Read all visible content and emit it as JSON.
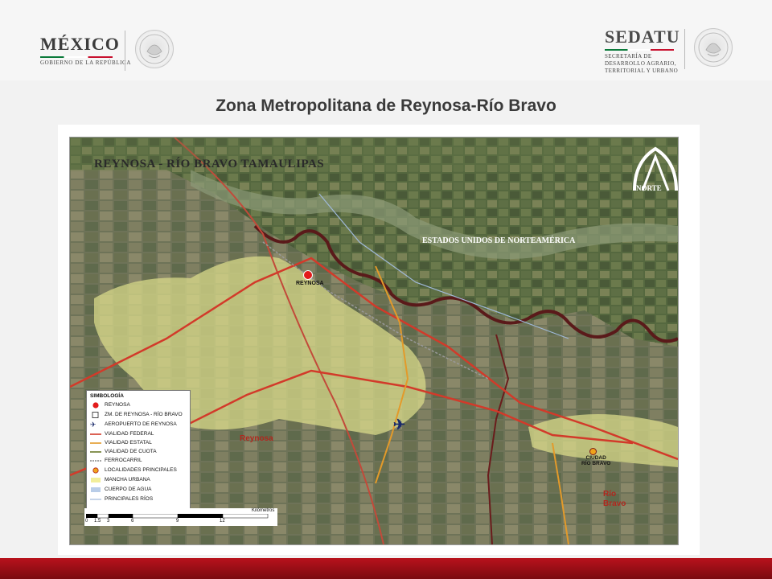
{
  "header": {
    "left_logo": {
      "name": "MÉXICO",
      "subtitle": "GOBIERNO DE LA REPÚBLICA"
    },
    "right_logo": {
      "name": "SEDATU",
      "line1": "SECRETARÍA DE",
      "line2": "DESARROLLO AGRARIO,",
      "line3": "TERRITORIAL Y URBANO"
    },
    "seal_text": "ESTADOS UNIDOS MEXICANOS"
  },
  "title": "Zona Metropolitana de Reynosa-Río Bravo",
  "map": {
    "banner": "REYNOSA - RÍO BRAVO  TAMAULIPAS",
    "north_label": "NORTE",
    "usa_label": "ESTADOS UNIDOS DE NORTEAMÉRICA",
    "reynosa_point": "REYNOSA",
    "reynosa_area": "Reynosa",
    "ciudad_rio_bravo_line1": "CIUDAD",
    "ciudad_rio_bravo_line2": "RÍO BRAVO",
    "rio_bravo_area_line1": "Río",
    "rio_bravo_area_line2": "Bravo",
    "colors": {
      "urban": "#d8d98a",
      "river_border": "#5a1a1a",
      "federal_road": "#d23a2a",
      "state_road": "#e39a2a",
      "toll_road": "#6b7a2a",
      "rivers": "#9fb8d8"
    }
  },
  "legend": {
    "title": "SIMBOLOGÍA",
    "items": [
      {
        "label": "REYNOSA",
        "icon": "red-circle"
      },
      {
        "label": "ZM. DE REYNOSA - RÍO BRAVO",
        "icon": "outline-square"
      },
      {
        "label": "AEROPUERTO DE REYNOSA",
        "icon": "airplane"
      },
      {
        "label": "VIALIDAD FEDERAL",
        "icon": "red-line"
      },
      {
        "label": "VIALIDAD ESTATAL",
        "icon": "orange-line"
      },
      {
        "label": "VIALIDAD DE CUOTA",
        "icon": "olive-line"
      },
      {
        "label": "FERROCARRIL",
        "icon": "railway-line"
      },
      {
        "label": "LOCALIDADES PRINCIPALES",
        "icon": "orange-circle"
      },
      {
        "label": "MANCHA URBANA",
        "icon": "yellow-fill"
      },
      {
        "label": "CUERPO DE AGUA",
        "icon": "blue-fill"
      },
      {
        "label": "PRINCIPALES RÍOS",
        "icon": "blue-line"
      }
    ]
  },
  "scale": {
    "unit": "Kilómetros",
    "ticks": [
      "0",
      "1.5",
      "3",
      "6",
      "9",
      "12"
    ]
  }
}
